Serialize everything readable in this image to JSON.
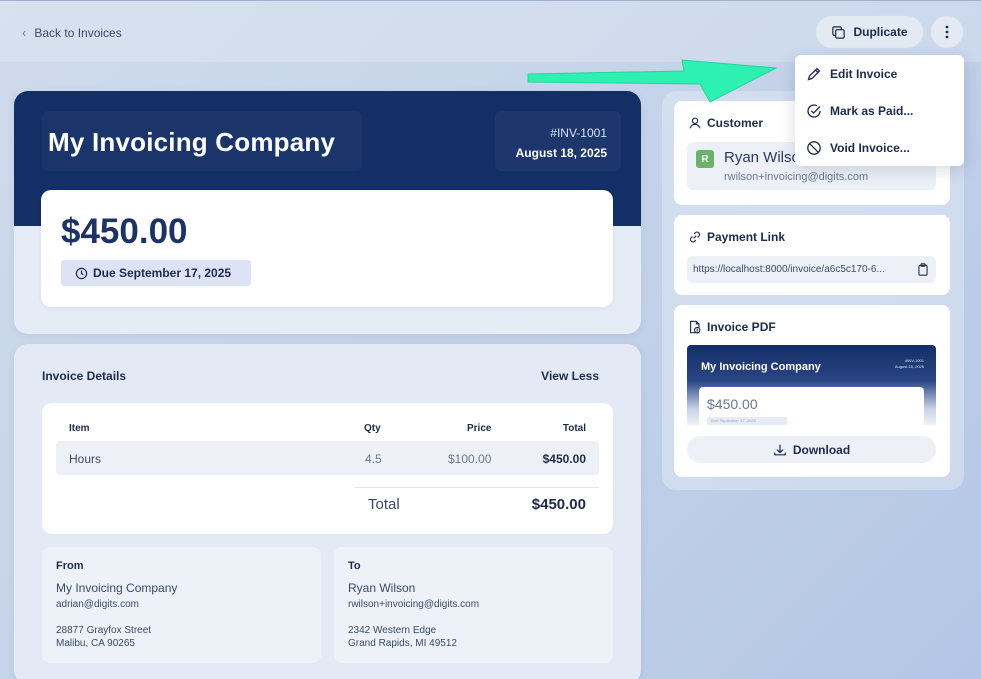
{
  "header": {
    "back_label": "Back to Invoices",
    "duplicate_label": "Duplicate"
  },
  "invoice": {
    "company": "My Invoicing Company",
    "number": "#INV-1001",
    "date": "August 18, 2025",
    "amount": "$450.00",
    "due": "Due September 17, 2025"
  },
  "details": {
    "title": "Invoice Details",
    "toggle_label": "View Less",
    "columns": [
      "Item",
      "Qty",
      "Price",
      "Total"
    ],
    "rows": [
      {
        "item": "Hours",
        "qty": "4.5",
        "price": "$100.00",
        "total": "$450.00"
      }
    ],
    "total_label": "Total",
    "total_value": "$450.00"
  },
  "from": {
    "title": "From",
    "name": "My Invoicing Company",
    "email": "adrian@digits.com",
    "street": "28877 Grayfox Street",
    "city": "Malibu, CA 90265"
  },
  "to": {
    "title": "To",
    "name": "Ryan Wilson",
    "email": "rwilson+invoicing@digits.com",
    "street": "2342 Western Edge",
    "city": "Grand Rapids, MI 49512"
  },
  "customer": {
    "heading": "Customer",
    "initial": "R",
    "name": "Ryan Wilson",
    "email": "rwilson+invoicing@digits.com"
  },
  "payment_link": {
    "heading": "Payment Link",
    "url": "https://localhost:8000/invoice/a6c5c170-6..."
  },
  "pdf": {
    "heading": "Invoice PDF",
    "company": "My Invoicing Company",
    "number": "#INV-1001",
    "date": "August 18, 2025",
    "amount": "$450.00",
    "due": "Due September 17, 2025",
    "download_label": "Download"
  },
  "menu": {
    "items": [
      {
        "label": "Edit Invoice",
        "icon": "pencil-icon"
      },
      {
        "label": "Mark as Paid...",
        "icon": "check-circle-icon"
      },
      {
        "label": "Void Invoice...",
        "icon": "ban-icon"
      }
    ]
  },
  "colors": {
    "navy": "#142e66",
    "arrow": "#2ef0b0",
    "avatar": "#6bb36b"
  }
}
